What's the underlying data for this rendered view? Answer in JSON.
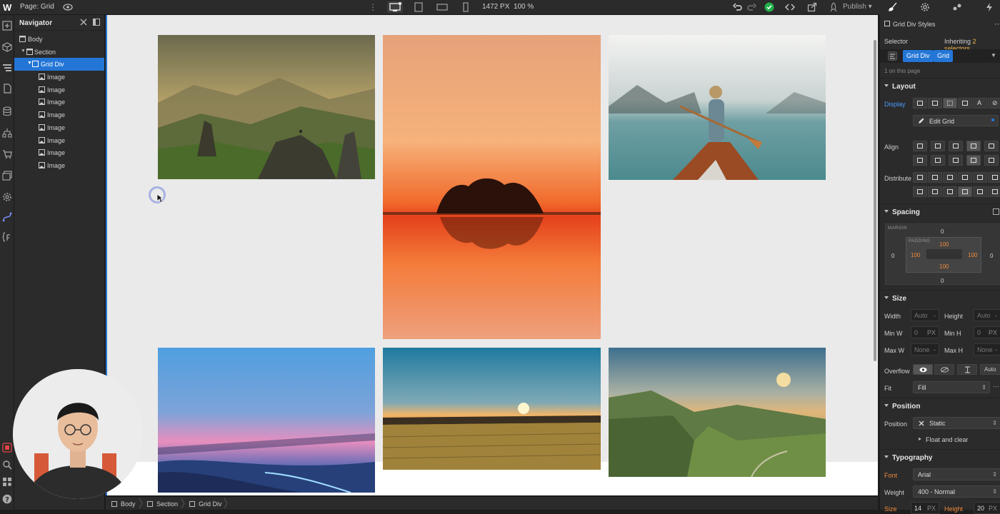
{
  "topbar": {
    "page_label": "Page: Grid",
    "width_value": "1472",
    "width_unit": "PX",
    "zoom": "100 %",
    "publish_label": "Publish",
    "dots": "⋮"
  },
  "navigator": {
    "title": "Navigator",
    "items": [
      {
        "label": "Body"
      },
      {
        "label": "Section"
      },
      {
        "label": "Grid Div"
      },
      {
        "label": "Image"
      },
      {
        "label": "Image"
      },
      {
        "label": "Image"
      },
      {
        "label": "Image"
      },
      {
        "label": "Image"
      },
      {
        "label": "Image"
      },
      {
        "label": "Image"
      },
      {
        "label": "Image"
      }
    ]
  },
  "breadcrumbs": [
    "Body",
    "Section",
    "Grid Div"
  ],
  "panel": {
    "element_title": "Grid Div Styles",
    "selector_label": "Selector",
    "inheriting_prefix": "Inheriting",
    "inheriting_count": "2 selectors",
    "chips": [
      "Grid Div",
      "Grid"
    ],
    "on_this_page": "1 on this page",
    "layout": {
      "title": "Layout",
      "display_label": "Display",
      "edit_grid_label": "Edit Grid",
      "align_label": "Align",
      "distribute_label": "Distribute"
    },
    "spacing": {
      "title": "Spacing",
      "margin_caption": "MARGIN",
      "padding_caption": "PADDING",
      "margin_top": "0",
      "margin_right": "0",
      "margin_bottom": "0",
      "margin_left": "0",
      "padding_top": "100",
      "padding_right": "100",
      "padding_bottom": "100",
      "padding_left": "100"
    },
    "size": {
      "title": "Size",
      "width_label": "Width",
      "width_value": "Auto",
      "height_label": "Height",
      "height_value": "Auto",
      "minw_label": "Min W",
      "minw_value": "0",
      "minw_unit": "PX",
      "minh_label": "Min H",
      "minh_value": "0",
      "minh_unit": "PX",
      "maxw_label": "Max W",
      "maxw_value": "None",
      "maxh_label": "Max H",
      "maxh_value": "None",
      "overflow_label": "Overflow",
      "overflow_auto": "Auto",
      "fit_label": "Fit",
      "fit_value": "Fill"
    },
    "position": {
      "title": "Position",
      "position_label": "Position",
      "position_value": "Static",
      "float_label": "Float and clear"
    },
    "typography": {
      "title": "Typography",
      "font_label": "Font",
      "font_value": "Arial",
      "weight_label": "Weight",
      "weight_value": "400 - Normal",
      "size_label": "Size",
      "size_value": "14",
      "size_unit": "PX",
      "height_label": "Height",
      "height_value": "20",
      "height_unit": "PX"
    }
  },
  "colors": {
    "accent": "#2476d6",
    "orange": "#f08a3c",
    "success": "#22b04a"
  }
}
